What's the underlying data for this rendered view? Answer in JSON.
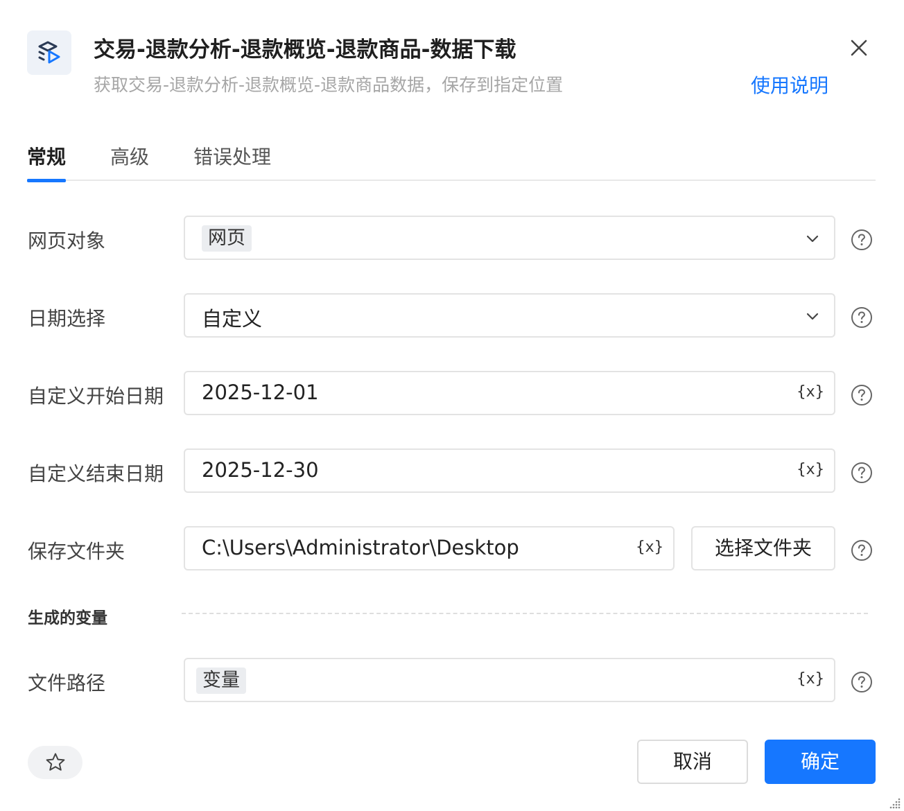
{
  "header": {
    "title": "交易-退款分析-退款概览-退款商品-数据下载",
    "subtitle": "获取交易-退款分析-退款概览-退款商品数据，保存到指定位置",
    "help_link": "使用说明",
    "app_icon": "layers-play-icon",
    "close_icon": "close-icon"
  },
  "tabs": [
    {
      "label": "常规",
      "active": true
    },
    {
      "label": "高级",
      "active": false
    },
    {
      "label": "错误处理",
      "active": false
    }
  ],
  "form": {
    "web_object": {
      "label": "网页对象",
      "value": "网页"
    },
    "date_select": {
      "label": "日期选择",
      "value": "自定义"
    },
    "start_date": {
      "label": "自定义开始日期",
      "value": "2025-12-01"
    },
    "end_date": {
      "label": "自定义结束日期",
      "value": "2025-12-30"
    },
    "save_folder": {
      "label": "保存文件夹",
      "value": "C:\\Users\\Administrator\\Desktop",
      "button": "选择文件夹"
    },
    "variable_icon_text": "{x}"
  },
  "output": {
    "section_title": "生成的变量",
    "file_path": {
      "label": "文件路径",
      "value": "变量"
    }
  },
  "footer": {
    "cancel": "取消",
    "confirm": "确定"
  },
  "colors": {
    "accent": "#1677ff",
    "border": "#e3e3e3",
    "chip_bg": "#ebedf0"
  }
}
